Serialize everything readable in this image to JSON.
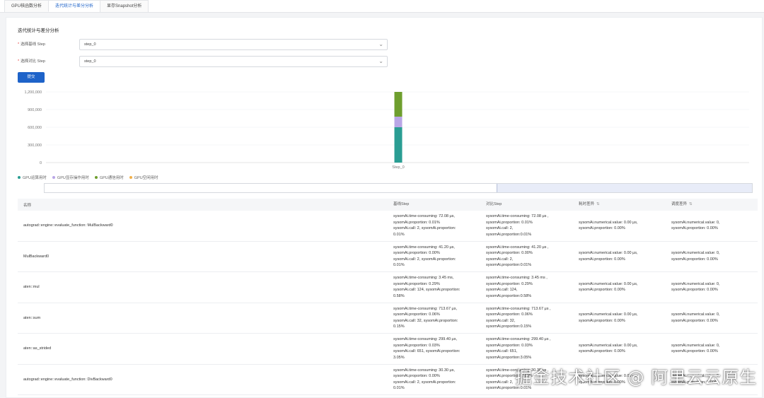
{
  "tabs": [
    {
      "label": "GPU核函数分析"
    },
    {
      "label": "迭代统计与差分分析"
    },
    {
      "label": "显存Snapshot分析"
    }
  ],
  "section_title": "迭代统计与差分分析",
  "form": {
    "baseline_label": "选择基线 Step",
    "baseline_value": "step_0",
    "compare_label": "选择对比 Step",
    "compare_value": "step_0",
    "submit_label": "提交"
  },
  "colors": {
    "accent": "#1e63c9",
    "compute": "#2a9d93",
    "memory": "#b9a6e6",
    "comm": "#6e9e2e",
    "idle": "#f2b14a"
  },
  "chart_data": {
    "type": "bar",
    "stacked": true,
    "categories": [
      "Step_0"
    ],
    "series": [
      {
        "name": "GPU运算用时",
        "values": [
          600000
        ],
        "color": "#2a9d93"
      },
      {
        "name": "GPU显存操作用时",
        "values": [
          180000
        ],
        "color": "#b9a6e6"
      },
      {
        "name": "GPU通信用时",
        "values": [
          420000
        ],
        "color": "#6e9e2e"
      },
      {
        "name": "GPU空闲用时",
        "values": [
          0
        ],
        "color": "#f2b14a"
      }
    ],
    "yticks": [
      "1,200,000",
      "900,000",
      "600,000",
      "300,000",
      "0"
    ],
    "ylim": [
      0,
      1200000
    ],
    "grid": true,
    "legend_position": "bottom-left"
  },
  "table": {
    "headers": [
      "名称",
      "基线Step",
      "对比Step",
      "耗时差异",
      "调度差异"
    ],
    "sort_icon": "⇅",
    "rows": [
      {
        "name": "autograd::engine::evaluate_function: MulBackward0",
        "base": [
          "sysomAi.time-consuming: 72.08 μs,",
          "sysomAi.proportion: 0.01%",
          "sysomAi.call: 2, sysomAi.proportion:",
          "0.01%"
        ],
        "cmp": [
          "sysomAi.time-consuming: 72.08 μs ,",
          "sysomAi.proportion: 0.01%",
          "sysomAi.call: 2,",
          "sysomAi.proportion:0.01%"
        ],
        "tdiff": [
          "sysomAi.numerical.value: 0.00 μs,",
          "sysomAi.proportion: 0.00%"
        ],
        "sdiff": [
          "sysomAi.numerical.value: 0,",
          "sysomAi.proportion: 0.00%"
        ]
      },
      {
        "name": "MulBackward0",
        "base": [
          "sysomAi.time-consuming: 41.20 μs,",
          "sysomAi.proportion: 0.00%",
          "sysomAi.call: 2, sysomAi.proportion:",
          "0.01%"
        ],
        "cmp": [
          "sysomAi.time-consuming: 41.20 μs ,",
          "sysomAi.proportion: 0.00%",
          "sysomAi.call: 2,",
          "sysomAi.proportion:0.01%"
        ],
        "tdiff": [
          "sysomAi.numerical.value: 0.00 μs,",
          "sysomAi.proportion: 0.00%"
        ],
        "sdiff": [
          "sysomAi.numerical.value: 0,",
          "sysomAi.proportion: 0.00%"
        ]
      },
      {
        "name": "aten::mul",
        "base": [
          "sysomAi.time-consuming: 3.45 ms,",
          "sysomAi.proportion: 0.29%",
          "sysomAi.call: 124, sysomAi.proportion:",
          "0.58%"
        ],
        "cmp": [
          "sysomAi.time-consuming: 3.45 ms ,",
          "sysomAi.proportion: 0.29%",
          "sysomAi.call: 124,",
          "sysomAi.proportion:0.58%"
        ],
        "tdiff": [
          "sysomAi.numerical.value: 0.00 μs,",
          "sysomAi.proportion: 0.00%"
        ],
        "sdiff": [
          "sysomAi.numerical.value: 0,",
          "sysomAi.proportion: 0.00%"
        ]
      },
      {
        "name": "aten::sum",
        "base": [
          "sysomAi.time-consuming: 713.67 μs,",
          "sysomAi.proportion: 0.06%",
          "sysomAi.call: 32, sysomAi.proportion:",
          "0.15%"
        ],
        "cmp": [
          "sysomAi.time-consuming: 713.67 μs ,",
          "sysomAi.proportion: 0.06%",
          "sysomAi.call: 32,",
          "sysomAi.proportion:0.15%"
        ],
        "tdiff": [
          "sysomAi.numerical.value: 0.00 μs,",
          "sysomAi.proportion: 0.00%"
        ],
        "sdiff": [
          "sysomAi.numerical.value: 0,",
          "sysomAi.proportion: 0.00%"
        ]
      },
      {
        "name": "aten::as_strided",
        "base": [
          "sysomAi.time-consuming: 299.40 μs,",
          "sysomAi.proportion: 0.03%",
          "sysomAi.call: 651, sysomAi.proportion:",
          "3.05%"
        ],
        "cmp": [
          "sysomAi.time-consuming: 299.40 μs ,",
          "sysomAi.proportion: 0.03%",
          "sysomAi.call: 651,",
          "sysomAi.proportion:3.05%"
        ],
        "tdiff": [
          "sysomAi.numerical.value: 0.00 μs,",
          "sysomAi.proportion: 0.00%"
        ],
        "sdiff": [
          "sysomAi.numerical.value: 0,",
          "sysomAi.proportion: 0.00%"
        ]
      },
      {
        "name": "autograd::engine::evaluate_function: DivBackward0",
        "base": [
          "sysomAi.time-consuming: 30.30 μs,",
          "sysomAi.proportion: 0.00%",
          "sysomAi.call: 2, sysomAi.proportion:",
          "0.01%"
        ],
        "cmp": [
          "sysomAi.time-consuming: 30.30 μs ,",
          "sysomAi.proportion: 0.00%",
          "sysomAi.call: 2,",
          "sysomAi.proportion:0.01%"
        ],
        "tdiff": [
          "sysomAi.numerical.value: 0.00 μs,",
          "sysomAi.proportion: 0.00%"
        ],
        "sdiff": [
          "sysomAi.numerical.value: 0,",
          "sysomAi.proportion: 0.00%"
        ]
      }
    ]
  },
  "watermark": "掘金技术社区 @ 阿里云云原生"
}
